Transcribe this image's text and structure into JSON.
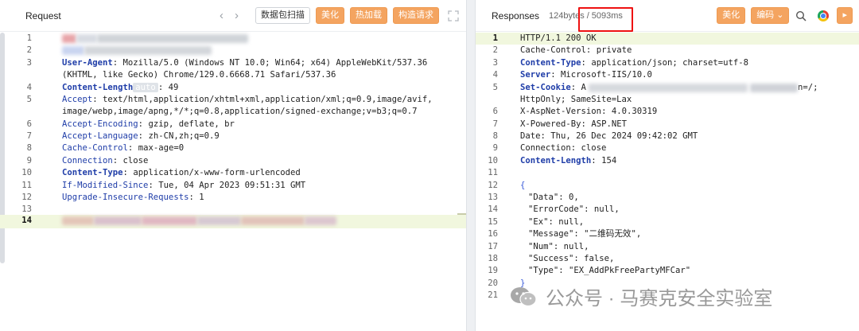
{
  "request": {
    "title": "Request",
    "buttons": {
      "scan": "数据包扫描",
      "beautify": "美化",
      "hot_load": "热加载",
      "construct": "构造请求"
    },
    "lines": [
      {
        "n": "1"
      },
      {
        "n": "2"
      },
      {
        "n": "3",
        "key": "User-Agent",
        "val": "Mozilla/5.0 (Windows NT 10.0; Win64; x64) AppleWebKit/537.36"
      },
      {
        "n": "",
        "val": "(KHTML, like Gecko) Chrome/129.0.6668.71 Safari/537.36"
      },
      {
        "n": "4",
        "key": "Content-Length",
        "tag": "auto",
        "val": "49"
      },
      {
        "n": "5",
        "key": "Accept",
        "val": "text/html,application/xhtml+xml,application/xml;q=0.9,image/avif,"
      },
      {
        "n": "",
        "val": "image/webp,image/apng,*/*;q=0.8,application/signed-exchange;v=b3;q=0.7"
      },
      {
        "n": "6",
        "key": "Accept-Encoding",
        "val": "gzip, deflate, br"
      },
      {
        "n": "7",
        "key": "Accept-Language",
        "val": "zh-CN,zh;q=0.9"
      },
      {
        "n": "8",
        "key": "Cache-Control",
        "val": "max-age=0"
      },
      {
        "n": "9",
        "key": "Connection",
        "val": "close"
      },
      {
        "n": "10",
        "key": "Content-Type",
        "val": "application/x-www-form-urlencoded"
      },
      {
        "n": "11",
        "key": "If-Modified-Since",
        "val": "Tue, 04 Apr 2023 09:51:31 GMT"
      },
      {
        "n": "12",
        "key": "Upgrade-Insecure-Requests",
        "val": "1"
      },
      {
        "n": "13"
      },
      {
        "n": "14"
      }
    ]
  },
  "response": {
    "title": "Responses",
    "size": "124bytes",
    "sep": "/",
    "time": "5093ms",
    "buttons": {
      "beautify": "美化",
      "encoding": "编码",
      "more": "▸"
    },
    "lines": [
      {
        "n": "1",
        "val": "HTTP/1.1 200 OK"
      },
      {
        "n": "2",
        "key": "Cache-Control",
        "val": "private"
      },
      {
        "n": "3",
        "key": "Content-Type",
        "val": "application/json; charset=utf-8"
      },
      {
        "n": "4",
        "key": "Server",
        "val": "Microsoft-IIS/10.0"
      },
      {
        "n": "5",
        "key": "Set-Cookie",
        "val": "A",
        "tail": "n=/;"
      },
      {
        "n": "",
        "val": "HttpOnly; SameSite=Lax"
      },
      {
        "n": "6",
        "key": "X-AspNet-Version",
        "val": "4.0.30319"
      },
      {
        "n": "7",
        "key": "X-Powered-By",
        "val": "ASP.NET"
      },
      {
        "n": "8",
        "key": "Date",
        "val": "Thu, 26 Dec 2024 09:42:02 GMT"
      },
      {
        "n": "9",
        "key": "Connection",
        "val": "close"
      },
      {
        "n": "10",
        "key": "Content-Length",
        "val": "154"
      },
      {
        "n": "11"
      },
      {
        "n": "12",
        "val": "{"
      },
      {
        "n": "13",
        "val": "\"Data\": 0,"
      },
      {
        "n": "14",
        "val": "\"ErrorCode\": null,"
      },
      {
        "n": "15",
        "val": "\"Ex\": null,"
      },
      {
        "n": "16",
        "val": "\"Message\": \"二维码无效\","
      },
      {
        "n": "17",
        "val": "\"Num\": null,"
      },
      {
        "n": "18",
        "val": "\"Success\": false,"
      },
      {
        "n": "19",
        "val": "\"Type\": \"EX_AddPkFreePartyMFCar\""
      },
      {
        "n": "20",
        "val": "}"
      },
      {
        "n": "21"
      }
    ]
  },
  "watermark": {
    "text": "公众号 · 马赛克安全实验室"
  },
  "colors": {
    "accent_orange": "#f4a460",
    "key_blue": "#1f3da8",
    "highlight_red": "#e11111",
    "active_line": "#f1f7de"
  }
}
